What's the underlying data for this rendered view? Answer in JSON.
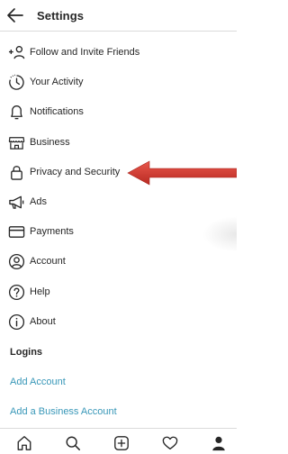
{
  "header": {
    "title": "Settings",
    "back_icon": "arrow-left-icon"
  },
  "menu": {
    "items": [
      {
        "label": "Follow and Invite Friends",
        "icon": "add-person-icon"
      },
      {
        "label": "Your Activity",
        "icon": "activity-clock-icon"
      },
      {
        "label": "Notifications",
        "icon": "bell-icon"
      },
      {
        "label": "Business",
        "icon": "store-icon"
      },
      {
        "label": "Privacy and Security",
        "icon": "lock-icon"
      },
      {
        "label": "Ads",
        "icon": "megaphone-icon"
      },
      {
        "label": "Payments",
        "icon": "card-icon"
      },
      {
        "label": "Account",
        "icon": "account-circle-icon"
      },
      {
        "label": "Help",
        "icon": "help-icon"
      },
      {
        "label": "About",
        "icon": "info-icon"
      }
    ]
  },
  "logins": {
    "title": "Logins",
    "add_account": "Add Account",
    "add_business_account": "Add a Business Account"
  },
  "annotation": {
    "arrow_color": "#d9382f",
    "points_to": "Privacy and Security"
  },
  "tabbar": {
    "icons": [
      "home-icon",
      "search-icon",
      "create-post-icon",
      "heart-icon",
      "profile-icon"
    ]
  },
  "colors": {
    "link": "#3897b8",
    "text": "#262626",
    "divider": "#dbdbdb"
  }
}
